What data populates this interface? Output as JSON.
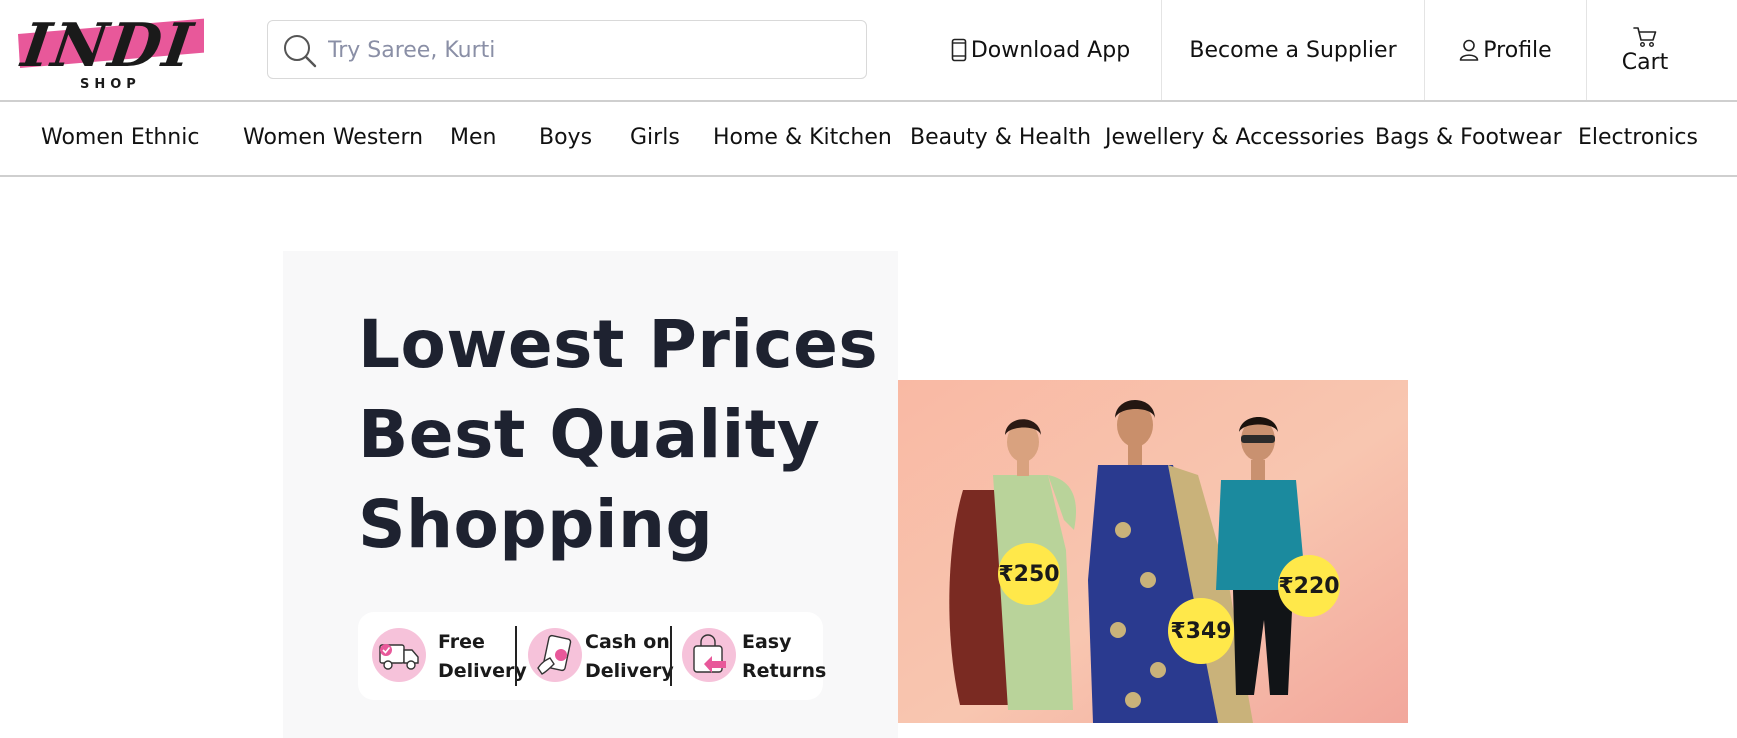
{
  "brand": {
    "name": "INDI",
    "sub": "SHOP",
    "accent": "#e8589a"
  },
  "search": {
    "placeholder": "Try Saree, Kurti"
  },
  "header_nav": {
    "download": "Download App",
    "supplier": "Become a Supplier",
    "profile": "Profile",
    "cart": "Cart"
  },
  "categories": [
    "Women Ethnic",
    "Women Western",
    "Men",
    "Boys",
    "Girls",
    "Home & Kitchen",
    "Beauty & Health",
    "Jewellery & Accessories",
    "Bags & Footwear",
    "Electronics"
  ],
  "hero": {
    "line1": "Lowest Prices",
    "line2": "Best Quality",
    "line3": "Shopping",
    "features": [
      {
        "icon": "delivery-truck-icon",
        "line1": "Free",
        "line2": "Delivery"
      },
      {
        "icon": "cash-hand-icon",
        "line1": "Cash on",
        "line2": "Delivery"
      },
      {
        "icon": "return-bag-icon",
        "line1": "Easy",
        "line2": "Returns"
      }
    ],
    "prices": [
      "₹250",
      "₹349",
      "₹220"
    ]
  },
  "colors": {
    "pink": "#e8589a",
    "heading": "#1e2230",
    "price_tag": "#ffe84a"
  }
}
